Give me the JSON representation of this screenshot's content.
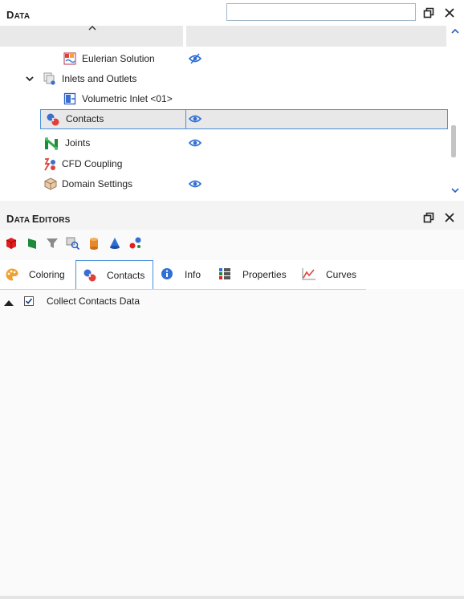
{
  "data_panel": {
    "title_first": "D",
    "title_rest": "ATA",
    "search": {
      "value": "",
      "placeholder": ""
    },
    "tree": [
      {
        "label": "Eulerian Solution",
        "icon": "eulerian-solution-icon",
        "visibility": "hidden"
      },
      {
        "label": "Inlets and Outlets",
        "icon": "inlets-outlets-icon",
        "expanded": true
      },
      {
        "label": "Volumetric Inlet <01>",
        "icon": "volumetric-inlet-icon"
      },
      {
        "label": "Contacts",
        "icon": "contacts-icon",
        "visibility": "visible",
        "selected": true
      },
      {
        "label": "Joints",
        "icon": "joints-icon",
        "visibility": "visible"
      },
      {
        "label": "CFD Coupling",
        "icon": "cfd-coupling-icon"
      },
      {
        "label": "Domain Settings",
        "icon": "domain-settings-icon",
        "visibility": "visible"
      }
    ]
  },
  "editors_panel": {
    "title_first": "D",
    "title_mid": "ATA ",
    "title_second": "E",
    "title_rest": "DITORS",
    "tabs": [
      {
        "label": "Coloring",
        "icon": "palette-icon"
      },
      {
        "label": "Contacts",
        "icon": "contacts-icon",
        "active": true
      },
      {
        "label": "Info",
        "icon": "info-icon"
      },
      {
        "label": "Properties",
        "icon": "properties-icon"
      },
      {
        "label": "Curves",
        "icon": "curves-icon"
      }
    ],
    "collect_contacts": {
      "label": "Collect Contacts Data",
      "checked": true
    }
  },
  "colors": {
    "accent": "#4a90d9",
    "eye": "#2f6fd6",
    "selected_bg": "#e8e8e8"
  }
}
